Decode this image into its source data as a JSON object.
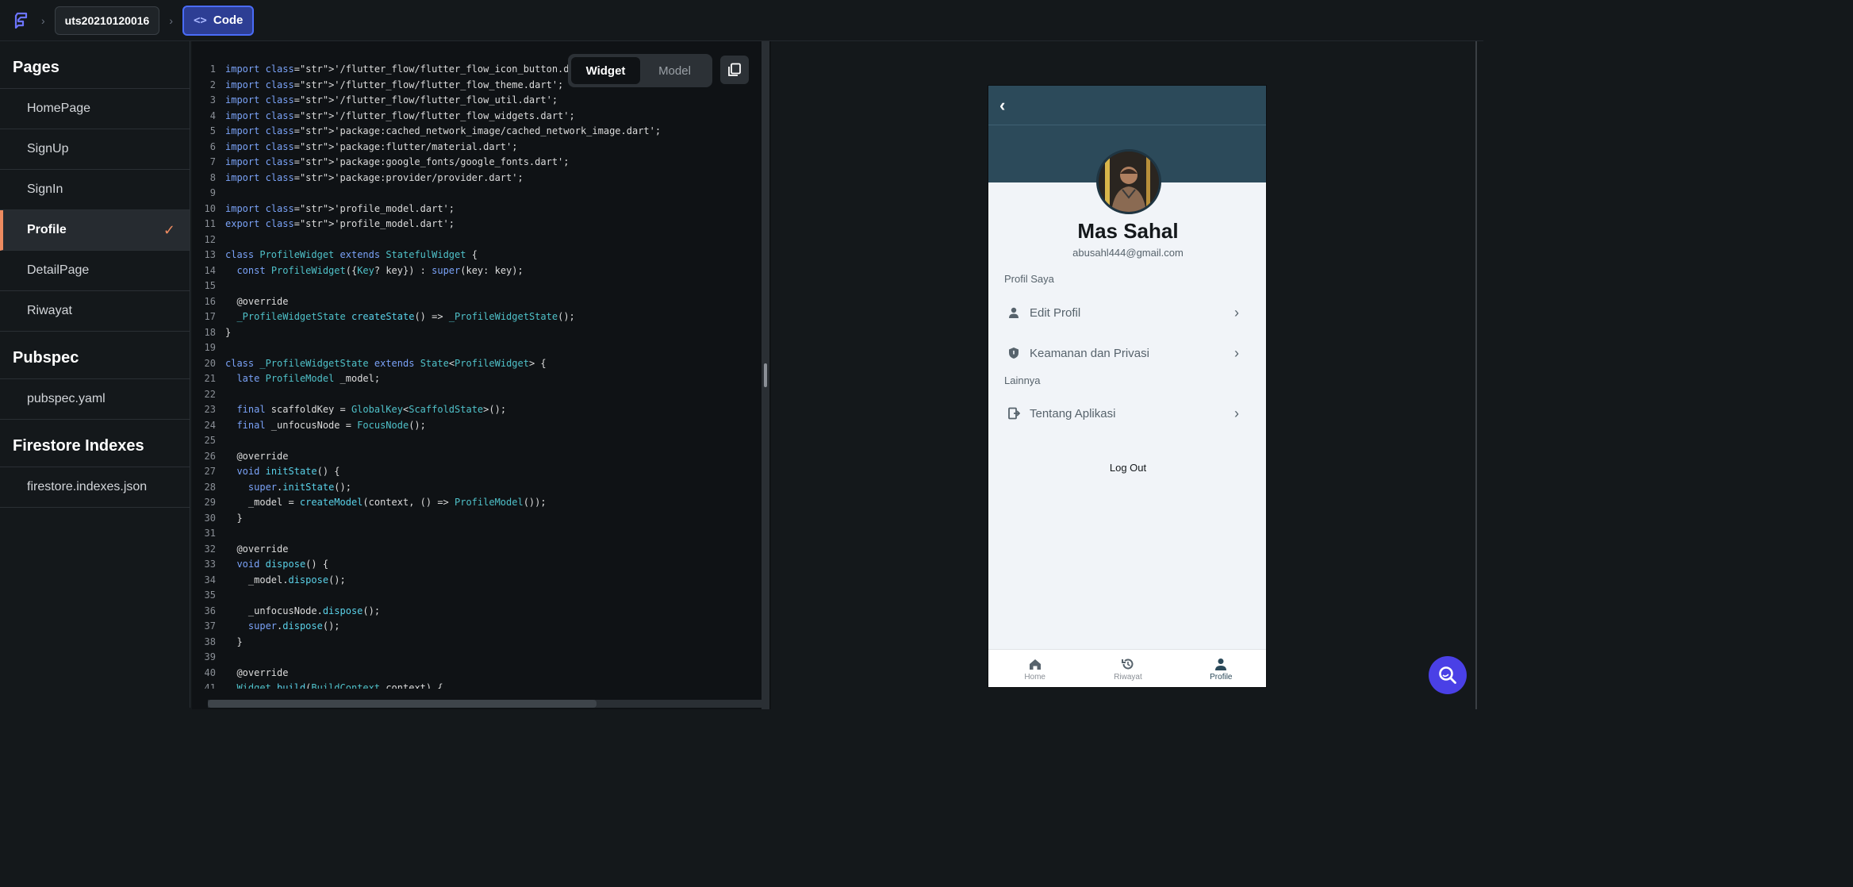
{
  "topbar": {
    "project_name": "uts20210120016",
    "code_label": "Code",
    "code_icon": "<>"
  },
  "sidebar": {
    "pages_title": "Pages",
    "pages": [
      {
        "label": "HomePage"
      },
      {
        "label": "SignUp"
      },
      {
        "label": "SignIn"
      },
      {
        "label": "Profile"
      },
      {
        "label": "DetailPage"
      },
      {
        "label": "Riwayat"
      }
    ],
    "active_page": "Profile",
    "pubspec_title": "Pubspec",
    "pubspec_items": [
      {
        "label": "pubspec.yaml"
      }
    ],
    "firestore_title": "Firestore Indexes",
    "firestore_items": [
      {
        "label": "firestore.indexes.json"
      }
    ]
  },
  "editor": {
    "toggle": {
      "widget": "Widget",
      "model": "Model"
    },
    "lines": [
      {
        "n": "1",
        "t": "import '/flutter_flow/flutter_flow_icon_button.dart';"
      },
      {
        "n": "2",
        "t": "import '/flutter_flow/flutter_flow_theme.dart';"
      },
      {
        "n": "3",
        "t": "import '/flutter_flow/flutter_flow_util.dart';"
      },
      {
        "n": "4",
        "t": "import '/flutter_flow/flutter_flow_widgets.dart';"
      },
      {
        "n": "5",
        "t": "import 'package:cached_network_image/cached_network_image.dart';"
      },
      {
        "n": "6",
        "t": "import 'package:flutter/material.dart';"
      },
      {
        "n": "7",
        "t": "import 'package:google_fonts/google_fonts.dart';"
      },
      {
        "n": "8",
        "t": "import 'package:provider/provider.dart';"
      },
      {
        "n": "9",
        "t": ""
      },
      {
        "n": "10",
        "t": "import 'profile_model.dart';"
      },
      {
        "n": "11",
        "t": "export 'profile_model.dart';"
      },
      {
        "n": "12",
        "t": ""
      },
      {
        "n": "13",
        "t": "class ProfileWidget extends StatefulWidget {"
      },
      {
        "n": "14",
        "t": "  const ProfileWidget({Key? key}) : super(key: key);"
      },
      {
        "n": "15",
        "t": ""
      },
      {
        "n": "16",
        "t": "  @override"
      },
      {
        "n": "17",
        "t": "  _ProfileWidgetState createState() => _ProfileWidgetState();"
      },
      {
        "n": "18",
        "t": "}"
      },
      {
        "n": "19",
        "t": ""
      },
      {
        "n": "20",
        "t": "class _ProfileWidgetState extends State<ProfileWidget> {"
      },
      {
        "n": "21",
        "t": "  late ProfileModel _model;"
      },
      {
        "n": "22",
        "t": ""
      },
      {
        "n": "23",
        "t": "  final scaffoldKey = GlobalKey<ScaffoldState>();"
      },
      {
        "n": "24",
        "t": "  final _unfocusNode = FocusNode();"
      },
      {
        "n": "25",
        "t": ""
      },
      {
        "n": "26",
        "t": "  @override"
      },
      {
        "n": "27",
        "t": "  void initState() {"
      },
      {
        "n": "28",
        "t": "    super.initState();"
      },
      {
        "n": "29",
        "t": "    _model = createModel(context, () => ProfileModel());"
      },
      {
        "n": "30",
        "t": "  }"
      },
      {
        "n": "31",
        "t": ""
      },
      {
        "n": "32",
        "t": "  @override"
      },
      {
        "n": "33",
        "t": "  void dispose() {"
      },
      {
        "n": "34",
        "t": "    _model.dispose();"
      },
      {
        "n": "35",
        "t": ""
      },
      {
        "n": "36",
        "t": "    _unfocusNode.dispose();"
      },
      {
        "n": "37",
        "t": "    super.dispose();"
      },
      {
        "n": "38",
        "t": "  }"
      },
      {
        "n": "39",
        "t": ""
      },
      {
        "n": "40",
        "t": "  @override"
      },
      {
        "n": "41",
        "t": "  Widget build(BuildContext context) {"
      }
    ]
  },
  "preview": {
    "name": "Mas Sahal",
    "email": "abusahl444@gmail.com",
    "section_profile": "Profil Saya",
    "items": [
      {
        "label": "Edit Profil",
        "icon": "person-icon"
      },
      {
        "label": "Keamanan dan Privasi",
        "icon": "shield-icon"
      }
    ],
    "section_other": "Lainnya",
    "other_items": [
      {
        "label": "Tentang Aplikasi",
        "icon": "exit-icon"
      }
    ],
    "logout": "Log Out",
    "nav": [
      {
        "label": "Home",
        "icon": "home-icon"
      },
      {
        "label": "Riwayat",
        "icon": "history-icon"
      },
      {
        "label": "Profile",
        "icon": "profile-icon"
      }
    ],
    "active_nav": "Profile",
    "colors": {
      "header": "#2c4a5a",
      "accent": "#ee8b60",
      "fab": "#4a40e6"
    }
  }
}
